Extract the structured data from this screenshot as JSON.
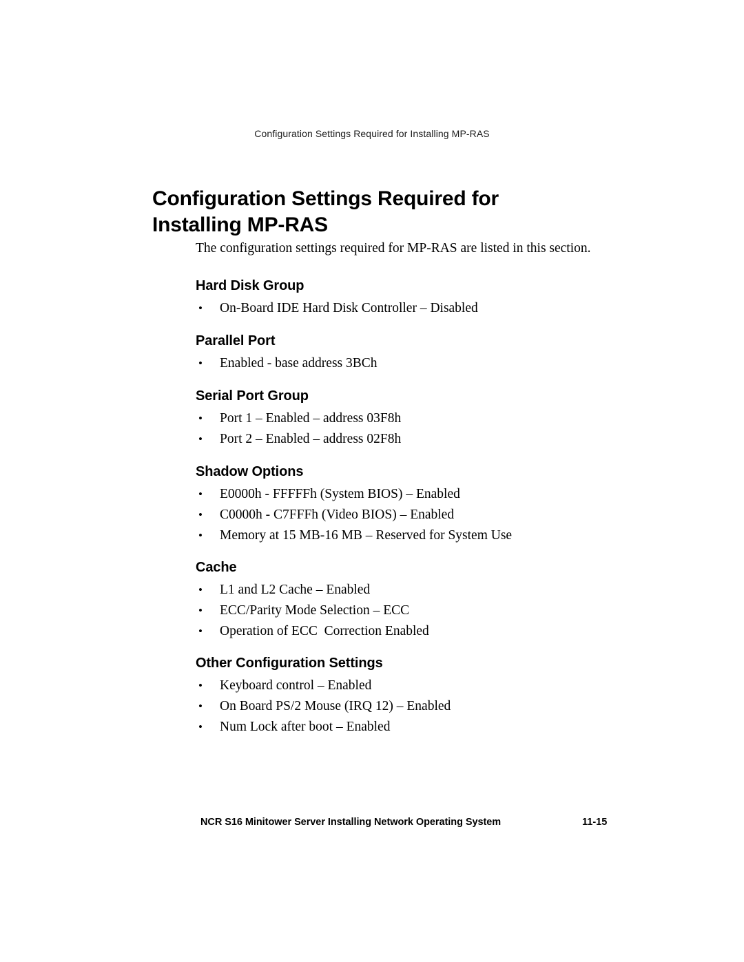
{
  "header": {
    "running_title": "Configuration Settings Required for Installing MP-RAS"
  },
  "title": {
    "line1": "Configuration Settings Required for",
    "line2": "Installing MP-RAS"
  },
  "intro": "The configuration settings required for MP-RAS are listed in this section.",
  "sections": [
    {
      "heading": "Hard Disk Group",
      "bullets": [
        "On-Board IDE Hard Disk Controller – Disabled"
      ]
    },
    {
      "heading": "Parallel Port",
      "bullets": [
        "Enabled - base address 3BCh"
      ]
    },
    {
      "heading": "Serial Port Group",
      "bullets": [
        "Port 1 – Enabled – address 03F8h",
        "Port 2 – Enabled – address 02F8h"
      ]
    },
    {
      "heading": "Shadow Options",
      "bullets": [
        "E0000h - FFFFFh (System BIOS) – Enabled",
        "C0000h - C7FFFh (Video BIOS) – Enabled",
        "Memory at 15 MB-16 MB – Reserved for System Use"
      ]
    },
    {
      "heading": "Cache",
      "bullets": [
        "L1 and L2 Cache – Enabled",
        "ECC/Parity Mode Selection – ECC",
        "Operation of ECC  Correction Enabled"
      ]
    },
    {
      "heading": "Other Configuration Settings",
      "bullets": [
        "Keyboard control – Enabled",
        "On Board PS/2 Mouse (IRQ 12) – Enabled",
        "Num Lock after boot – Enabled"
      ]
    }
  ],
  "footer": {
    "text": "NCR S16 Minitower Server Installing Network Operating System",
    "page_number": "11-15"
  },
  "bullet_glyph": "•",
  "colors": {
    "page_background": "#ffffff",
    "text": "#000000"
  }
}
